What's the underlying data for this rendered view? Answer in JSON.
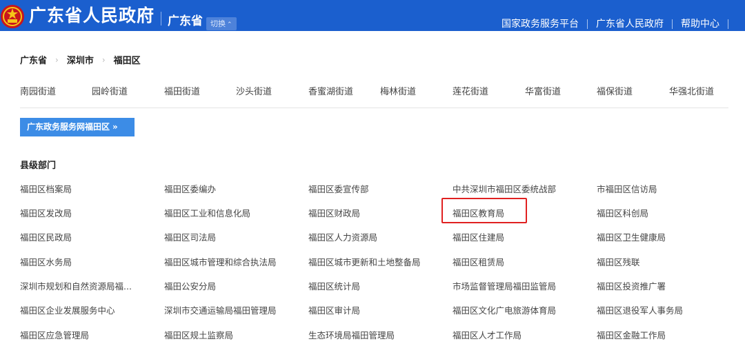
{
  "header": {
    "site_title": "广东省人民政府",
    "region": "广东省",
    "switch_label": "切换",
    "links": [
      "国家政务服务平台",
      "广东省人民政府",
      "帮助中心"
    ],
    "colors": {
      "bar": "#1b5fce",
      "emblem_red": "#c8161d",
      "emblem_gold": "#f5c518"
    }
  },
  "breadcrumb": [
    "广东省",
    "深圳市",
    "福田区"
  ],
  "streets": [
    "南园街道",
    "园岭街道",
    "福田街道",
    "沙头街道",
    "香蜜湖街道",
    "梅林街道",
    "莲花街道",
    "华富街道",
    "福保街道",
    "华强北街道"
  ],
  "banner": {
    "label": "广东政务服务网福田区",
    "arrows": "»",
    "color": "#3c8ce6"
  },
  "section": {
    "title": "县级部门",
    "departments": [
      [
        "福田区档案局",
        "福田区委编办",
        "福田区委宣传部",
        "中共深圳市福田区委统战部",
        "市福田区信访局"
      ],
      [
        "福田区发改局",
        "福田区工业和信息化局",
        "福田区财政局",
        "福田区教育局",
        "福田区科创局"
      ],
      [
        "福田区民政局",
        "福田区司法局",
        "福田区人力资源局",
        "福田区住建局",
        "福田区卫生健康局"
      ],
      [
        "福田区水务局",
        "福田区城市管理和综合执法局",
        "福田区城市更新和土地整备局",
        "福田区租赁局",
        "福田区残联"
      ],
      [
        "深圳市规划和自然资源局福...",
        "福田公安分局",
        "福田区统计局",
        "市场监督管理局福田监管局",
        "福田区投资推广署"
      ],
      [
        "福田区企业发展服务中心",
        "深圳市交通运输局福田管理局",
        "福田区审计局",
        "福田区文化广电旅游体育局",
        "福田区退役军人事务局"
      ],
      [
        "福田区应急管理局",
        "福田区规土监察局",
        "生态环境局福田管理局",
        "福田区人才工作局",
        "福田区金融工作局"
      ]
    ],
    "highlighted": "福田区教育局",
    "highlight_color": "#e02020"
  }
}
